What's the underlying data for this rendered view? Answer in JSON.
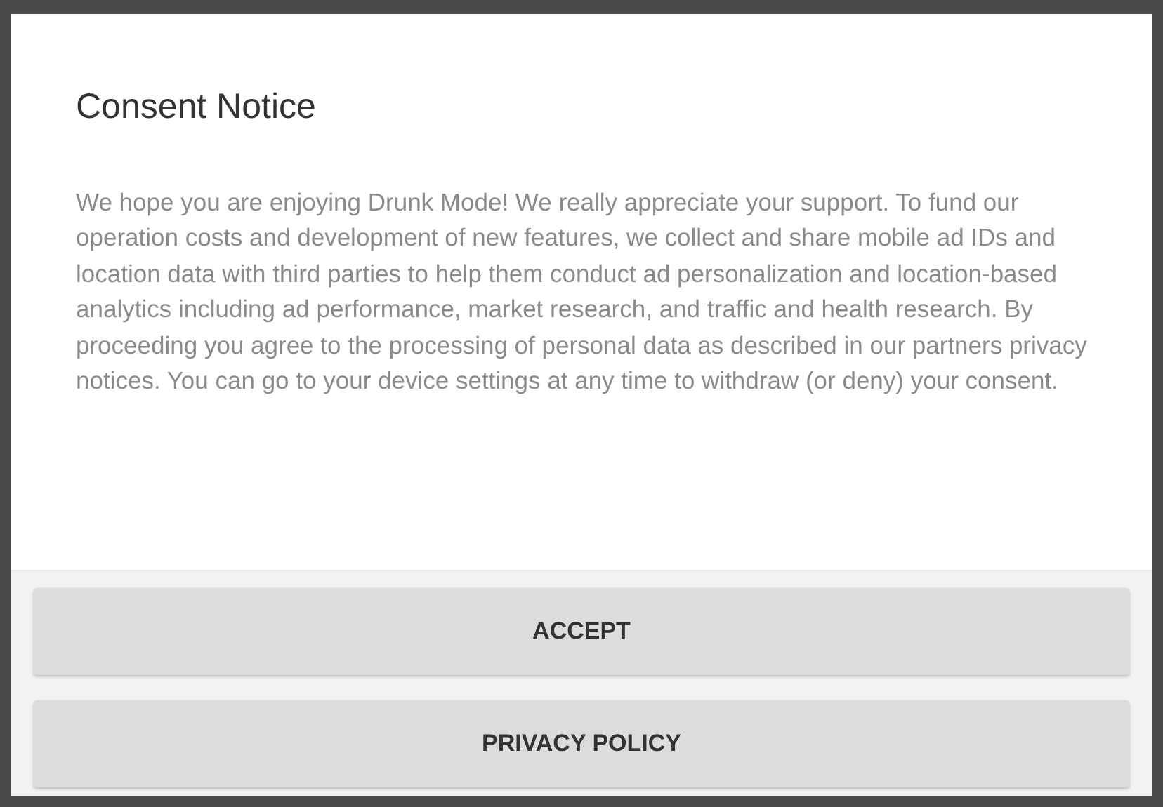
{
  "dialog": {
    "title": "Consent Notice",
    "message": "We hope you are enjoying Drunk Mode! We really appreciate your support. To fund our operation costs and development of new features, we collect and share mobile ad IDs and location data with third parties to help them conduct ad personalization and location-based analytics including ad performance, market research, and traffic and health research. By proceeding you agree to the processing of personal data as described in our partners privacy notices. You can go to your device settings at any time to withdraw (or deny) your consent.",
    "buttons": [
      {
        "label": "ACCEPT"
      },
      {
        "label": "PRIVACY POLICY"
      }
    ]
  }
}
